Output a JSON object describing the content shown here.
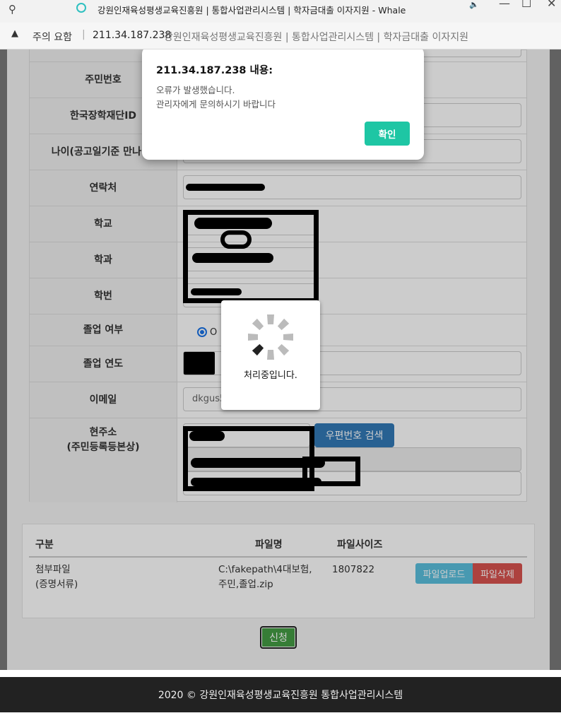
{
  "window": {
    "title": "강원인재육성평생교육진흥원 | 통합사업관리시스템 | 학자금대출 이자지원 - Whale",
    "pin_icon": "pin-icon",
    "minimize": "—",
    "maximize": "☐",
    "close": "✕"
  },
  "address": {
    "warning": "주의 요함",
    "separator": "|",
    "host": "211.34.187.238",
    "page_title": "강원인재육성평생교육진흥원 | 통합사업관리시스템 | 학자금대출 이자지원"
  },
  "form": {
    "rows": [
      {
        "label": "주민번호"
      },
      {
        "label": "한국장학재단ID"
      },
      {
        "label": "나이(공고일기준 만나이)"
      },
      {
        "label": "연락처"
      },
      {
        "label": "학교"
      },
      {
        "label": "학과"
      },
      {
        "label": "학번"
      },
      {
        "label": "졸업 여부"
      },
      {
        "label": "졸업 연도"
      },
      {
        "label": "이메일"
      },
      {
        "label": "현주소\n(주민등록등본상)"
      }
    ],
    "graduation_option": "O",
    "email_value": "dkgus5",
    "zip_button": "우편번호 검색"
  },
  "files": {
    "headers": {
      "type": "구분",
      "name": "파일명",
      "size": "파일사이즈"
    },
    "row": {
      "type": "첨부파일\n(증명서류)",
      "name": "C:\\fakepath\\4대보험,\n주민,졸업.zip",
      "size": "1807822",
      "upload": "파일업로드",
      "delete": "파일삭제"
    }
  },
  "submit": "신청",
  "footer": "2020 © 강원인재육성평생교육진흥원 통합사업관리시스템",
  "loading": {
    "message": "처리중입니다."
  },
  "alert": {
    "title": "211.34.187.238 내용:",
    "line1": "오류가 발생했습니다.",
    "line2": "관리자에게 문의하시기 바랍니다",
    "ok": "확인"
  },
  "colors": {
    "alert_ok": "#1ec6a4",
    "zip_button": "#337ab7",
    "upload": "#5bc0de",
    "delete": "#d9534f",
    "submit": "#449d44",
    "footer": "#222222"
  }
}
